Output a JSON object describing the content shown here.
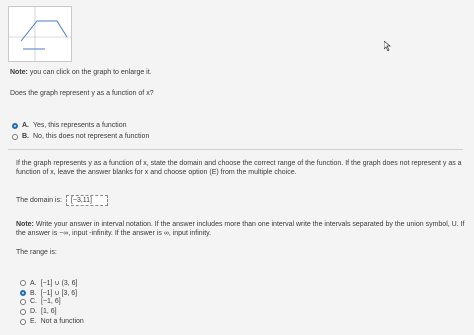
{
  "note_top": {
    "prefix": "Note:",
    "text": " you can click on the graph to enlarge it."
  },
  "question1": "Does the graph represent y as a function of x?",
  "options1": [
    {
      "letter": "A.",
      "text": "Yes, this represents a function",
      "selected": true
    },
    {
      "letter": "B.",
      "text": "No, this does not represent a function",
      "selected": false
    }
  ],
  "instruction": "If the graph represents y as a function of x, state the domain and choose the correct range of the function. If the graph does not represent y as a function of x, leave the answer blanks for x and choose option (E) from the multiple choice.",
  "domain": {
    "label": "The domain is:",
    "value": "[−3,11]"
  },
  "note_interval": {
    "prefix": "Note:",
    "text": " Write your answer in interval notation. If the answer includes more than one interval write the intervals separated by the union symbol, U. If the answer is −∞, input -infinity. If the answer is ∞, input infinity."
  },
  "range_label": "The range is:",
  "range_options": [
    {
      "letter": "A.",
      "text": "[−1] ∪ (3, 6]",
      "selected": false
    },
    {
      "letter": "B.",
      "text": "[−1] ∪ [3, 6]",
      "selected": true
    },
    {
      "letter": "C.",
      "text": "[−1, 6]",
      "selected": false
    },
    {
      "letter": "D.",
      "text": "[1, 6]",
      "selected": false
    },
    {
      "letter": "E.",
      "text": "Not a function",
      "selected": false
    }
  ]
}
